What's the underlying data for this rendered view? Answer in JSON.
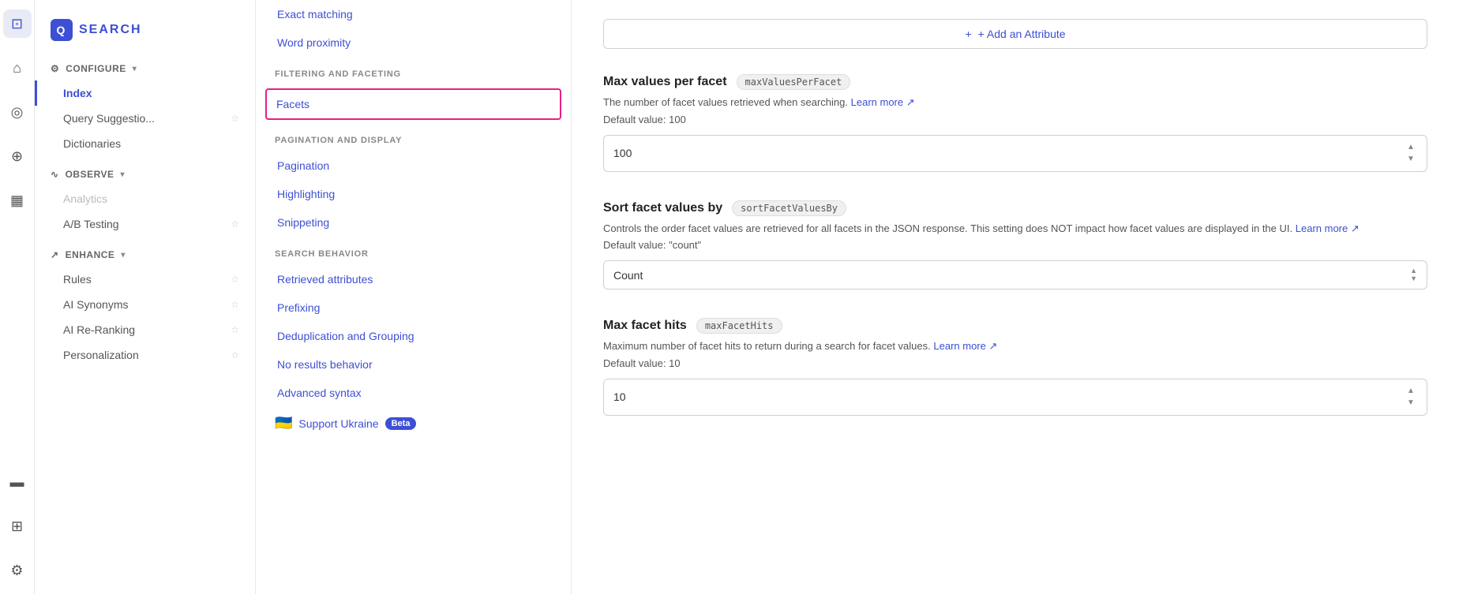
{
  "iconbar": {
    "icons": [
      "⊡",
      "⌂",
      "◎",
      "⊕",
      "▦",
      "⊞"
    ]
  },
  "sidebar": {
    "brand": "SEARCH",
    "sections": [
      {
        "label": "CONFIGURE",
        "icon": "⚙",
        "items": [
          {
            "label": "Index",
            "active": true,
            "star": false
          },
          {
            "label": "Query Suggestio...",
            "active": false,
            "star": true
          },
          {
            "label": "Dictionaries",
            "active": false,
            "star": false
          }
        ]
      },
      {
        "label": "OBSERVE",
        "icon": "∿",
        "items": [
          {
            "label": "Analytics",
            "active": false,
            "star": false,
            "disabled": true
          },
          {
            "label": "A/B Testing",
            "active": false,
            "star": true
          }
        ]
      },
      {
        "label": "ENHANCE",
        "icon": "↗",
        "items": [
          {
            "label": "Rules",
            "active": false,
            "star": true
          },
          {
            "label": "AI Synonyms",
            "active": false,
            "star": true
          },
          {
            "label": "AI Re-Ranking",
            "active": false,
            "star": true
          },
          {
            "label": "Personalization",
            "active": false,
            "star": true
          }
        ]
      }
    ]
  },
  "navpanel": {
    "top_items": [
      {
        "label": "Exact matching"
      },
      {
        "label": "Word proximity"
      }
    ],
    "sections": [
      {
        "label": "FILTERING AND FACETING",
        "items": [
          {
            "label": "Facets",
            "active": true
          }
        ]
      },
      {
        "label": "PAGINATION AND DISPLAY",
        "items": [
          {
            "label": "Pagination"
          },
          {
            "label": "Highlighting"
          },
          {
            "label": "Snippeting"
          }
        ]
      },
      {
        "label": "SEARCH BEHAVIOR",
        "items": [
          {
            "label": "Retrieved attributes"
          },
          {
            "label": "Prefixing"
          },
          {
            "label": "Deduplication and Grouping"
          },
          {
            "label": "No results behavior"
          },
          {
            "label": "Advanced syntax"
          }
        ]
      }
    ],
    "support_ukraine": {
      "label": "Support Ukraine",
      "badge": "Beta"
    }
  },
  "main": {
    "add_attribute_label": "+ Add an Attribute",
    "settings": [
      {
        "title": "Max values per facet",
        "badge": "maxValuesPerFacet",
        "desc": "The number of facet values retrieved when searching.",
        "learn_more": "Learn more",
        "default_value": "Default value: 100",
        "input_type": "number",
        "value": "100"
      },
      {
        "title": "Sort facet values by",
        "badge": "sortFacetValuesBy",
        "desc": "Controls the order facet values are retrieved for all facets in the JSON response. This setting does NOT impact how facet values are displayed in the UI.",
        "learn_more": "Learn more",
        "default_value": "Default value: \"count\"",
        "input_type": "select",
        "value": "Count"
      },
      {
        "title": "Max facet hits",
        "badge": "maxFacetHits",
        "desc": "Maximum number of facet hits to return during a search for facet values.",
        "learn_more": "Learn more",
        "default_value": "Default value: 10",
        "input_type": "number",
        "value": "10"
      }
    ]
  }
}
